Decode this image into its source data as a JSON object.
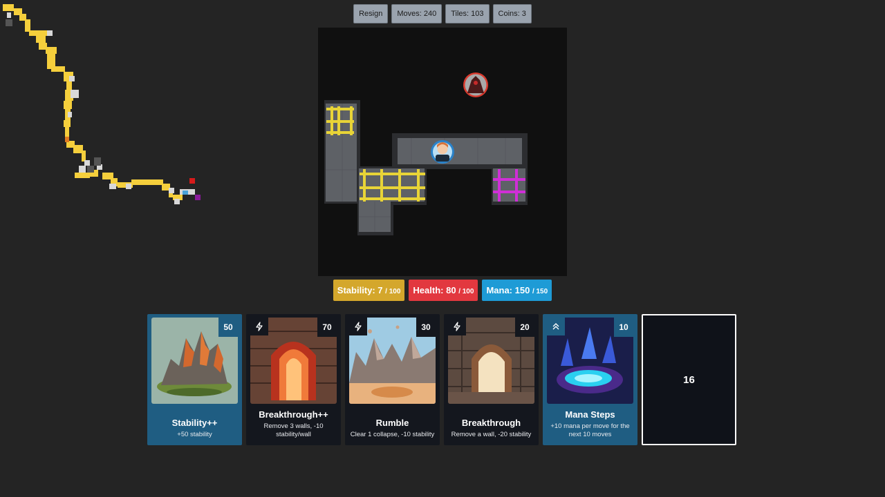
{
  "toolbar": {
    "resign_label": "Resign",
    "moves_text": "Moves: 240",
    "tiles_text": "Tiles: 103",
    "coins_text": "Coins: 3"
  },
  "stats": {
    "stability_label": "Stability: 7",
    "stability_max": "/ 100",
    "health_label": "Health: 80",
    "health_max": "/ 100",
    "mana_label": "Mana: 150",
    "mana_max": "/ 150"
  },
  "colors": {
    "stability": "#d4a72c",
    "health": "#e2383f",
    "mana": "#1e9bd6",
    "path": "#f5cf3c",
    "portal": "#cf2fd6"
  },
  "cards": [
    {
      "cost": "50",
      "title": "Stability++",
      "desc": "+50 stability",
      "icon": "none",
      "art": "rock-island"
    },
    {
      "cost": "70",
      "title": "Breakthrough++",
      "desc": "Remove 3 walls, -10 stability/wall",
      "icon": "lightning-icon",
      "art": "red-tunnel"
    },
    {
      "cost": "30",
      "title": "Rumble",
      "desc": "Clear 1 collapse, -10 stability",
      "icon": "lightning-icon",
      "art": "rock-canyon"
    },
    {
      "cost": "20",
      "title": "Breakthrough",
      "desc": "Remove a wall, -20 stability",
      "icon": "lightning-icon",
      "art": "stone-arch"
    },
    {
      "cost": "10",
      "title": "Mana Steps",
      "desc": "+10 mana per move for the next 10 moves",
      "icon": "double-chevron-up-icon",
      "art": "crystal-pool"
    }
  ],
  "deck": {
    "count": "16"
  }
}
